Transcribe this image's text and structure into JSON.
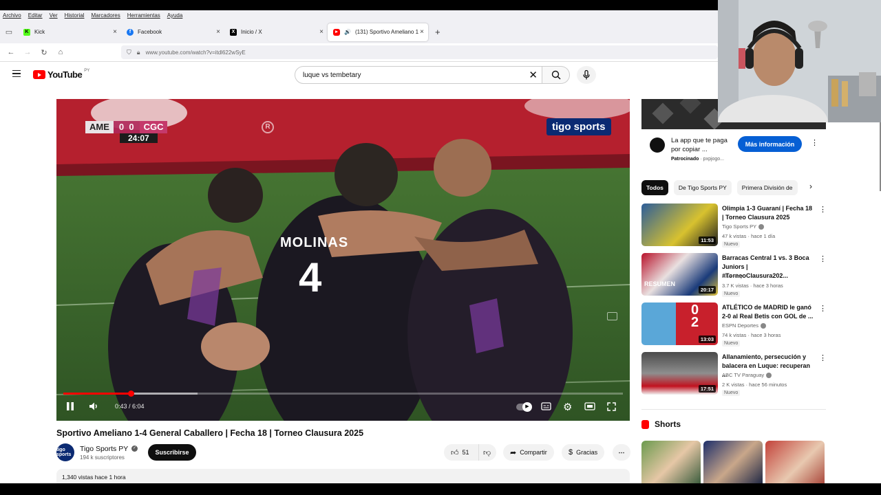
{
  "menu": [
    "Archivo",
    "Editar",
    "Ver",
    "Historial",
    "Marcadores",
    "Herramientas",
    "Ayuda"
  ],
  "tabs": [
    {
      "label": "Kick",
      "icon": "kick-icon",
      "color": "#53fc18"
    },
    {
      "label": "Facebook",
      "icon": "facebook-icon",
      "color": "#1877f2"
    },
    {
      "label": "Inicio / X",
      "icon": "x-icon",
      "color": "#000000"
    },
    {
      "label": "(131) Sportivo Ameliano 1 -",
      "icon": "youtube-icon",
      "color": "#ff0000"
    }
  ],
  "url": "www.youtube.com/watch?v=itdl622wSyE",
  "youtube": {
    "logo_text": "YouTube",
    "country": "PY",
    "search_value": "luque vs tembetary"
  },
  "player": {
    "scorebug": {
      "home": "AME",
      "home_score": "0",
      "away_score": "0",
      "away": "CGC",
      "clock": "24:07"
    },
    "broadcaster": "tigo sports",
    "jersey_name": "MOLINAS",
    "jersey_number": "4",
    "time_current": "0:43",
    "time_total": "6:04",
    "time_readout": "0:43 / 6:04",
    "progress_played": 0.12,
    "progress_loaded": 0.24
  },
  "video": {
    "title": "Sportivo Ameliano 1-4 General Caballero | Fecha 18 | Torneo Clausura 2025",
    "channel": "Tigo Sports PY",
    "channel_avatar_text": "tigo sports",
    "subscribers": "194 k suscriptores",
    "subscribe_label": "Suscribirse",
    "likes": "51",
    "share_label": "Compartir",
    "thanks_label": "Gracias",
    "description_meta": "1,340 vistas  hace 1 hora"
  },
  "ad": {
    "text": "La app que te paga por copiar ...",
    "sponsored": "Patrocinado",
    "domain": "· pxpjogo...",
    "cta": "Más información"
  },
  "chips": [
    "Todos",
    "De Tigo Sports PY",
    "Primera División de"
  ],
  "recommendations": [
    {
      "title": "Olimpia 1-3 Guaraní | Fecha 18 | Torneo Clausura 2025",
      "channel": "Tigo Sports PY",
      "verified": true,
      "meta": "47 k vistas · hace 1 día",
      "badge": "Nuevo",
      "duration": "11:53"
    },
    {
      "title": "Barracas Central 1 vs. 3 Boca Juniors | #TorneoClausura202...",
      "channel": "AFA Play",
      "verified": false,
      "meta": "3.7 K vistas · hace 3 horas",
      "badge": "Nuevo",
      "duration": "20:17"
    },
    {
      "title": "ATLÉTICO de MADRID le ganó 2-0 al Real Betis con GOL de ...",
      "channel": "ESPN Deportes",
      "verified": true,
      "meta": "74 k vistas · hace 3 horas",
      "badge": "Nuevo",
      "duration": "13:03"
    },
    {
      "title": "Allanamiento, persecución y balacera en Luque: recuperan ...",
      "channel": "ABC TV Paraguay",
      "verified": true,
      "meta": "2 K vistas · hace 56 minutos",
      "badge": "Nuevo",
      "duration": "17:51"
    }
  ],
  "shorts_title": "Shorts",
  "colors": {
    "accent": "#ff0000",
    "link": "#065fd4",
    "dark": "#0f0f0f"
  }
}
